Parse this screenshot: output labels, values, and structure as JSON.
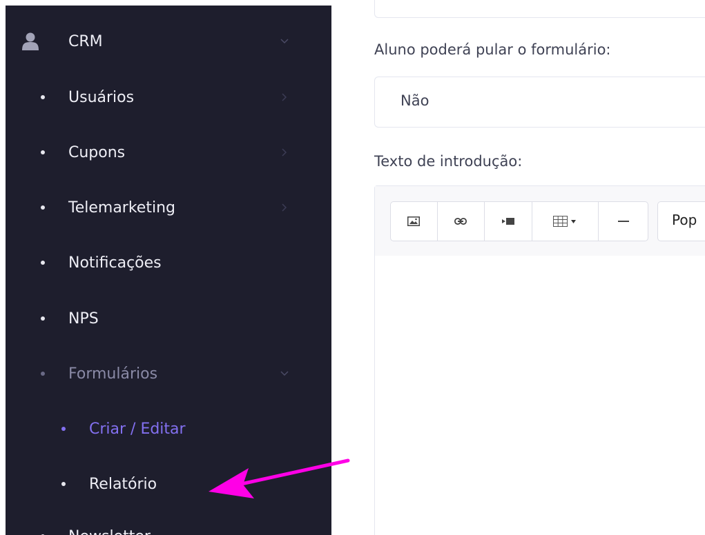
{
  "sidebar": {
    "items": [
      {
        "label": "CRM"
      },
      {
        "label": "Usuários"
      },
      {
        "label": "Cupons"
      },
      {
        "label": "Telemarketing"
      },
      {
        "label": "Notificações"
      },
      {
        "label": "NPS"
      },
      {
        "label": "Formulários"
      },
      {
        "label": "Criar / Editar"
      },
      {
        "label": "Relatório"
      },
      {
        "label": "Newsletter"
      }
    ]
  },
  "form": {
    "skip_label": "Aluno poderá pular o formulário:",
    "skip_value": "Não",
    "intro_label": "Texto de introdução:"
  },
  "editor": {
    "font_name": "Pop",
    "icons": [
      "picture-icon",
      "link-icon",
      "video-icon",
      "table-icon",
      "horizontal-rule-icon"
    ]
  },
  "colors": {
    "sidebar_bg": "#1e1e2d",
    "active_item": "#8370f0",
    "annotation_arrow": "#ff00e6"
  }
}
